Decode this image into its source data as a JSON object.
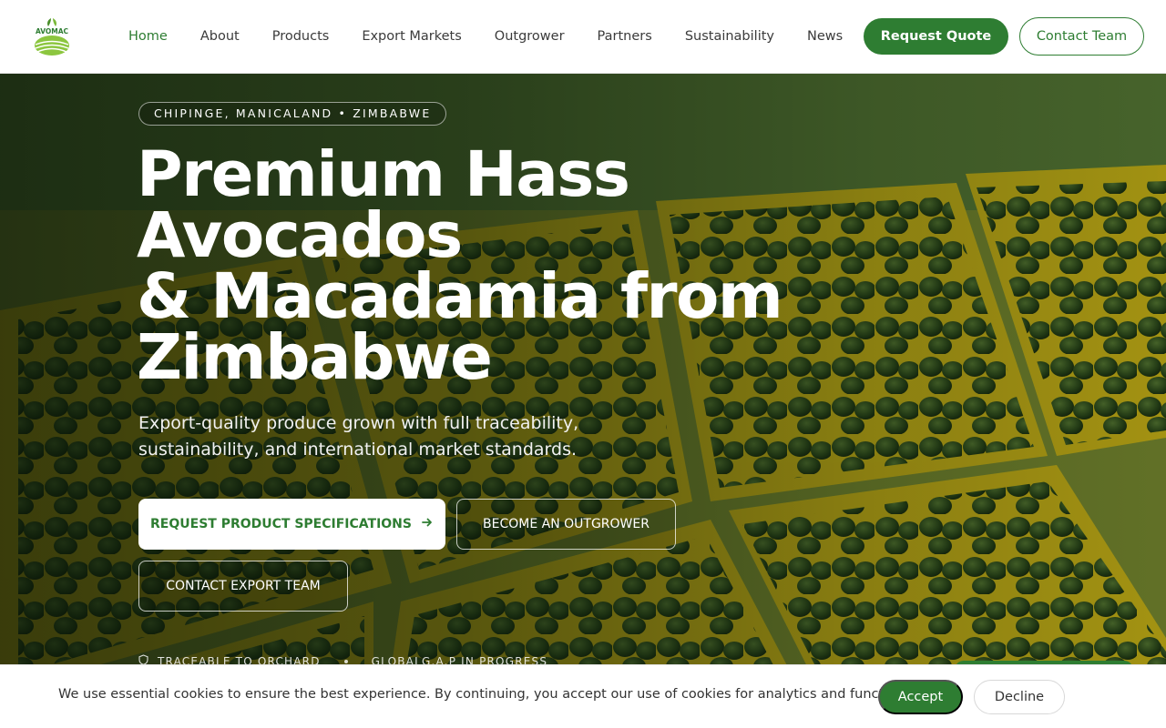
{
  "brand": {
    "logo_text": "AVOMAC",
    "logo_icon": "avocado-leaf-logo"
  },
  "nav": {
    "items": [
      {
        "label": "Home",
        "active": true
      },
      {
        "label": "About"
      },
      {
        "label": "Products"
      },
      {
        "label": "Export Markets"
      },
      {
        "label": "Outgrower"
      },
      {
        "label": "Partners"
      },
      {
        "label": "Sustainability"
      },
      {
        "label": "News"
      }
    ],
    "request_quote": "Request Quote",
    "contact_team": "Contact Team"
  },
  "hero": {
    "location": "CHIPINGE, MANICALAND • ZIMBABWE",
    "title_lines": [
      "Premium Hass",
      "Avocados",
      "& Macadamia from",
      "Zimbabwe"
    ],
    "subtitle": "Export-quality produce grown with full traceability, sustainability, and international market standards.",
    "cta_primary": "REQUEST PRODUCT SPECIFICATIONS",
    "cta_primary_icon": "arrow-right-icon",
    "cta_outgrower": "BECOME AN OUTGROWER",
    "cta_export": "CONTACT EXPORT TEAM",
    "trust": [
      {
        "icon": "shield-icon",
        "label": "TRACEABLE TO ORCHARD"
      },
      {
        "label": "GLOBALG.A.P IN PROGRESS"
      }
    ]
  },
  "cookie": {
    "message": "We use essential cookies to ensure the best experience. By continuing, you accept our use of cookies for analytics and functionality.",
    "accept": "Accept",
    "decline": "Decline"
  },
  "colors": {
    "brand_green": "#2e7d32",
    "header_bg": "#ffffff",
    "hero_text": "#ffffff"
  }
}
